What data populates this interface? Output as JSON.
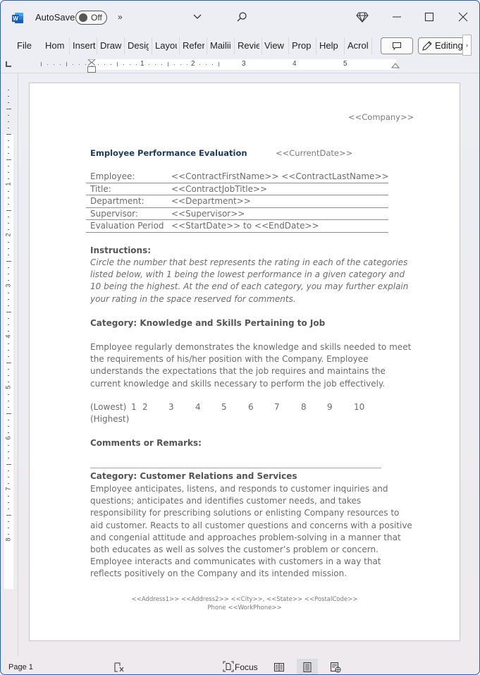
{
  "app": {
    "name": "Word",
    "autosave_label": "AutoSave",
    "autosave_state": "Off",
    "more_commands": "»",
    "window_controls": [
      "minimize-icon",
      "maximize-icon",
      "close-icon"
    ]
  },
  "ribbon": {
    "tabs": [
      "File",
      "Home",
      "Insert",
      "Draw",
      "Design",
      "Layout",
      "References",
      "Mailings",
      "Review",
      "View",
      "Properties",
      "Help",
      "Acrobat"
    ],
    "tabs_visible_text": [
      "File",
      "Hom",
      "Insert",
      "Draw",
      "Desig",
      "Layou",
      "Refer",
      "Mailii",
      "Revie",
      "View",
      "Prop",
      "Help",
      "Acrol"
    ],
    "comment_button": "comment-icon",
    "editing_label": "Editing",
    "scroll_right": "›"
  },
  "ruler": {
    "horizontal_numbers": [
      "1",
      "2",
      "3",
      "4",
      "5"
    ],
    "vertical_numbers": [
      "1",
      "2",
      "3",
      "4",
      "5",
      "6",
      "7",
      "8"
    ]
  },
  "document": {
    "company": "<<Company>>",
    "title": "Employee Performance Evaluation",
    "current_date": "<<CurrentDate>>",
    "info_rows": [
      {
        "label": "Employee:",
        "value": "<<ContractFirstName>> <<ContractLastName>>"
      },
      {
        "label": "Title:",
        "value": "<<ContractJobTitle>>"
      },
      {
        "label": "Department:",
        "value": "<<Department>>"
      },
      {
        "label": "Supervisor:",
        "value": "<<Supervisor>>"
      },
      {
        "label": "Evaluation Period",
        "value": "<<StartDate>> to <<EndDate>>"
      }
    ],
    "instructions_heading": "Instructions:",
    "instructions_text": "Circle the number that best represents the rating in each of the categories listed below, with 1 being the lowest performance in a given category and 10 being the highest. At the end of each category, you may further explain your rating in the space reserved for comments.",
    "category1_heading": "Category: Knowledge and Skills Pertaining to Job",
    "category1_text": "Employee regularly demonstrates the knowledge and skills needed to meet the requirements of his/her position with the Company. Employee understands the expectations that the job requires and maintains the current knowledge and skills necessary to perform the job effectively.",
    "scale": {
      "lowest_label": "(Lowest)",
      "numbers": [
        "1",
        "2",
        "3",
        "4",
        "5",
        "6",
        "7",
        "8",
        "9",
        "10"
      ],
      "highest_label": "(Highest)"
    },
    "comments_heading": "Comments or Remarks:",
    "category2_heading": "Category: Customer Relations and Services",
    "category2_text": "Employee anticipates, listens, and responds to customer inquiries and questions; anticipates and identifies customer needs, and takes responsibility for prescribing solutions or enlisting Company resources to aid customer. Reacts to all customer questions and concerns with a positive and congenial attitude and approaches problem-solving in a manner that both educates as well as solves the customer’s problem or concern. Employee interacts and communicates with customers in a way that reflects positively on the Company and its intended mission.",
    "footer_line1": "<<Address1>> <<Address2>> <<City>>, <<State>> <<PostalCode>>",
    "footer_line2": "Phone <<WorkPhone>>"
  },
  "statusbar": {
    "page_label": "Page 1",
    "focus_label": "Focus",
    "views": [
      "read-mode",
      "print-layout",
      "web-layout"
    ],
    "active_view": "print-layout"
  },
  "colors": {
    "window_border": "#2c5fb4",
    "word_brand": "#185abd",
    "title_text": "#1f3a63",
    "body_text": "#6b6b6b"
  }
}
